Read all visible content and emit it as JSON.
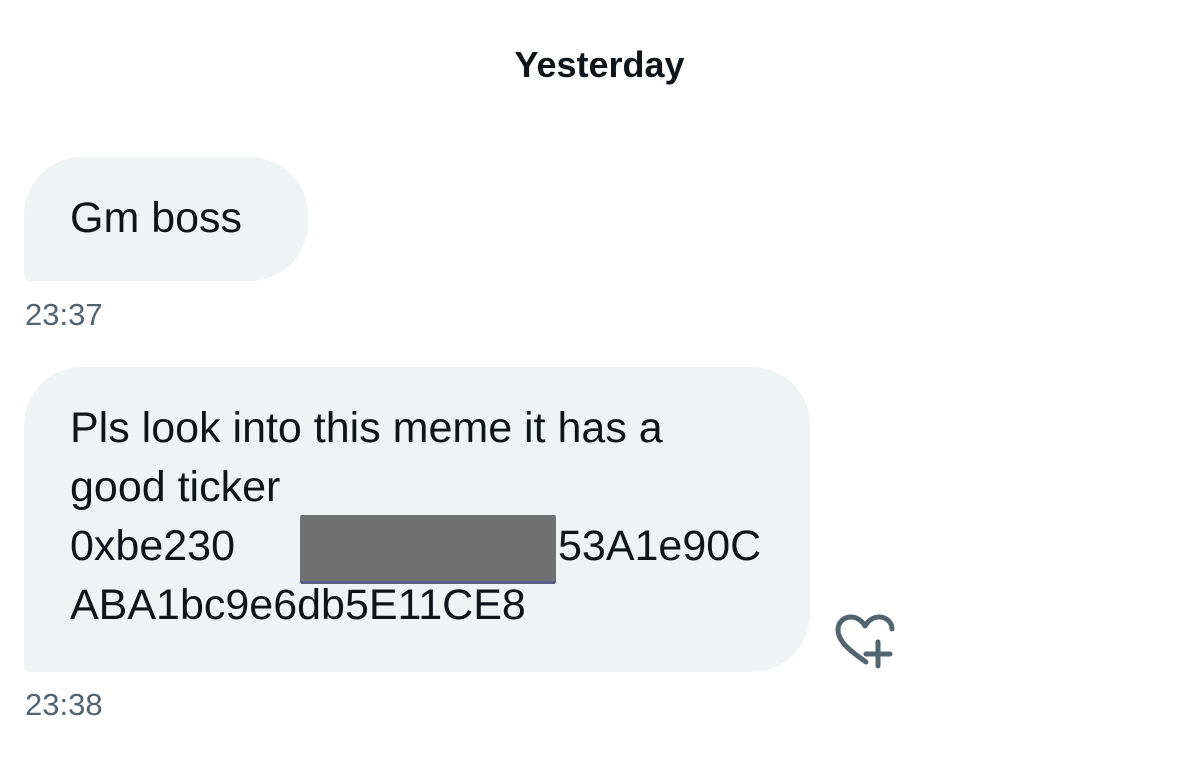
{
  "date_separator": "Yesterday",
  "messages": [
    {
      "lines": [
        "Gm boss"
      ],
      "time": "23:37"
    },
    {
      "lines": [
        "Pls look into this meme it has a",
        "good ticker",
        "0xbe230",
        "53A1e90C",
        "ABA1bc9e6db5E11CE8"
      ],
      "time": "23:38"
    }
  ],
  "icons": {
    "react": "heart-plus-icon"
  },
  "colors": {
    "bubble_bg": "#eff3f4",
    "text": "#0f1419",
    "muted": "#536471",
    "icon": "#536471"
  }
}
